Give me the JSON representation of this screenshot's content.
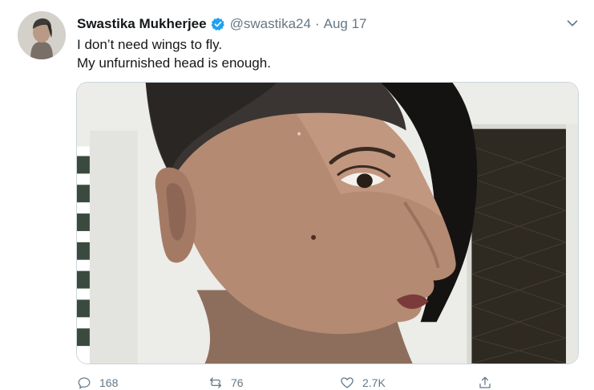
{
  "tweet": {
    "author_name": "Swastika Mukherjee",
    "handle": "@swastika24",
    "separator": "·",
    "date": "Aug 17",
    "text_lines": [
      "I don’t need wings to fly.",
      "My unfurnished head is enough."
    ],
    "verified": true
  },
  "actions": {
    "reply_count": "168",
    "retweet_count": "76",
    "like_count": "2.7K"
  },
  "icons": {
    "verified": "verified-badge-icon",
    "caret": "chevron-down-icon",
    "reply": "reply-icon",
    "retweet": "retweet-icon",
    "like": "heart-icon",
    "share": "share-icon"
  },
  "colors": {
    "text_primary": "#14171a",
    "text_secondary": "#657786",
    "verified_blue": "#1da1f2",
    "border": "#ccd6dd"
  }
}
